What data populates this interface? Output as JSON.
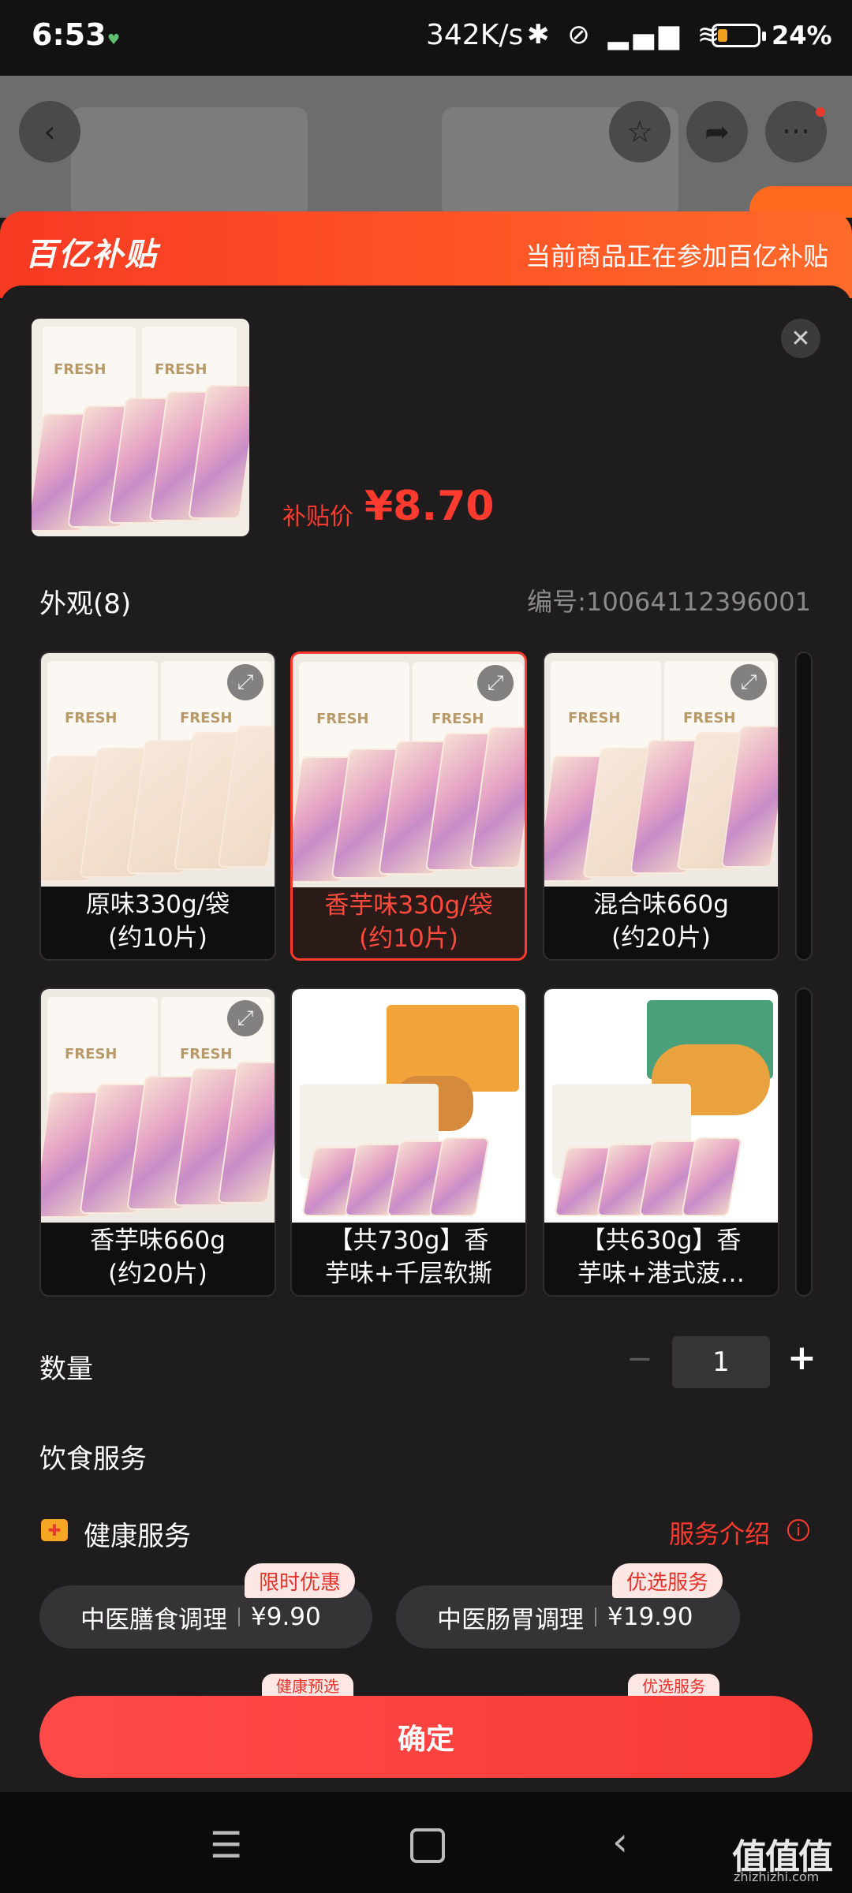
{
  "status_bar": {
    "time": "6:53",
    "net_speed": "342K/s",
    "icons": "✱ ⊘ ▂▄▆ ≋",
    "battery_percent": "24%",
    "battery_level": 0.24
  },
  "background_page": {
    "back_icon": "‹",
    "star_icon": "☆",
    "share_icon": "➦",
    "more_icon": "···"
  },
  "subsidy": {
    "logo": "百亿补贴",
    "note": "当前商品正在参加百亿补贴"
  },
  "sheet": {
    "close_icon": "✕",
    "price_label": "补贴价",
    "price_value": "¥8.70",
    "appearance_title": "外观(8)",
    "sku_code": "编号:10064112396001",
    "bag_text": "FRESH",
    "variants": [
      {
        "label": "原味330g/袋\n(约10片)",
        "line1": "原味330g/袋",
        "line2": "(约10片)",
        "selected": false
      },
      {
        "label": "香芋味330g/袋(约10片)",
        "line1": "香芋味330g/袋",
        "line2": "(约10片)",
        "selected": true
      },
      {
        "label": "混合味660g(约20片)",
        "line1": "混合味660g",
        "line2": "(约20片)",
        "selected": false
      },
      {
        "label": "香芋味660g(约20片)",
        "line1": "香芋味660g",
        "line2": "(约20片)",
        "selected": false
      },
      {
        "label": "【共730g】香芋味+千层软撕",
        "line1": "【共730g】香",
        "line2": "芋味+千层软撕",
        "selected": false
      },
      {
        "label": "【共630g】香芋味+港式菠…",
        "line1": "【共630g】香",
        "line2": "芋味+港式菠…",
        "selected": false
      }
    ],
    "zoom_icon": "⤢",
    "quantity": {
      "label": "数量",
      "minus": "−",
      "value": "1",
      "plus": "+"
    },
    "food_service_title": "饮食服务",
    "health": {
      "icon": "✚",
      "title": "健康服务",
      "intro": "服务介绍",
      "info_icon": "i",
      "options": [
        {
          "name": "中医膳食调理",
          "price": "¥9.90",
          "tag": "限时优惠"
        },
        {
          "name": "中医肠胃调理",
          "price": "¥19.90",
          "tag": "优选服务"
        }
      ],
      "partial_tags": [
        "健康预选",
        "优选服务"
      ]
    },
    "confirm_label": "确定"
  },
  "nav_bar": {
    "menu_icon": "☰",
    "back_icon": "‹"
  },
  "watermark": {
    "text": "值值值",
    "sub": "zhizhizhi.com"
  }
}
